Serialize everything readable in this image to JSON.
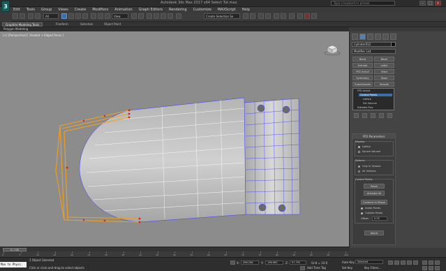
{
  "window": {
    "title": "Autodesk 3ds Max 2017 x64    Select Tut.max",
    "search_placeholder": "Type a keyword or phrase",
    "logo_text": "3"
  },
  "menu": [
    "Edit",
    "Tools",
    "Group",
    "Views",
    "Create",
    "Modifiers",
    "Animation",
    "Graph Editors",
    "Rendering",
    "Customize",
    "MAXScript",
    "Help"
  ],
  "toolbar": {
    "filter_value": "All",
    "refcoord_value": "View",
    "selection_set_placeholder": "Create Selection Se"
  },
  "ribbon": {
    "tabs": [
      "Graphite Modeling Tools",
      "Freeform",
      "Selection",
      "Object Paint"
    ],
    "active_tab": "Graphite Modeling Tools",
    "sub_label": "Polygon Modeling"
  },
  "viewport": {
    "label": "[+] [Perspective] [ Shaded + Edged Faces ]"
  },
  "command_panel": {
    "object_name": "Cylinder012",
    "modifier_list_label": "Modifier List",
    "modifier_buttons": [
      "Bend",
      "Bevel",
      "Extrude",
      "Lathe",
      "FFD 3x3x3",
      "Shell",
      "Symmetry",
      "Taper",
      "TurboSmooth",
      "Smooth"
    ],
    "stack": {
      "ffd_label": "FFD 4x4x4",
      "sub_items": [
        "Control Points",
        "Lattice",
        "Set Volume"
      ],
      "selected": "Control Points",
      "base": "Editable Poly"
    },
    "rollout_title": "FFD Parameters",
    "display": {
      "label": "Display:",
      "lattice": "Lattice",
      "source_volume": "Source Volume"
    },
    "deform": {
      "label": "Deform:",
      "only_in_volume": "Only In Volume",
      "all_vertices": "All Vertices"
    },
    "control_points": {
      "label": "Control Points:",
      "reset": "Reset",
      "animate_all": "Animate All",
      "conform_to_shape": "Conform to Shape",
      "inside_points": "Inside Points",
      "outside_points": "Outside Points",
      "offset_label": "Offset:",
      "offset_value": "0.05"
    },
    "about_button": "About"
  },
  "timeline": {
    "slider_label": "0 / 100",
    "ticks": [
      "0",
      "5",
      "10",
      "15",
      "20",
      "25",
      "30",
      "35",
      "40",
      "45",
      "50",
      "55",
      "60",
      "65",
      "70",
      "75",
      "80",
      "85",
      "90",
      "95",
      "100"
    ]
  },
  "status": {
    "maxscript_label": "Max to Physc.",
    "selection_count": "1 Object Selected",
    "prompt": "Click or click-and-drag to select objects",
    "x_label": "X:",
    "x_value": "496.206",
    "y_label": "Y:",
    "y_value": "196.963",
    "z_label": "Z:",
    "z_value": "97.791",
    "grid": "Grid = 10.0",
    "add_time_tag": "Add Time Tag",
    "auto_key": "Auto Key",
    "auto_key_value": "Selected",
    "set_key": "Set Key",
    "key_filters": "Key Filters..."
  },
  "colors": {
    "viewport_bg": "#8c8c8c",
    "lattice": "#f0a020",
    "lattice_point": "#d02020",
    "mesh_vertex": "#3a3aff",
    "selection_blue": "#3b6ea8",
    "logo_teal": "#1a5e5c"
  }
}
